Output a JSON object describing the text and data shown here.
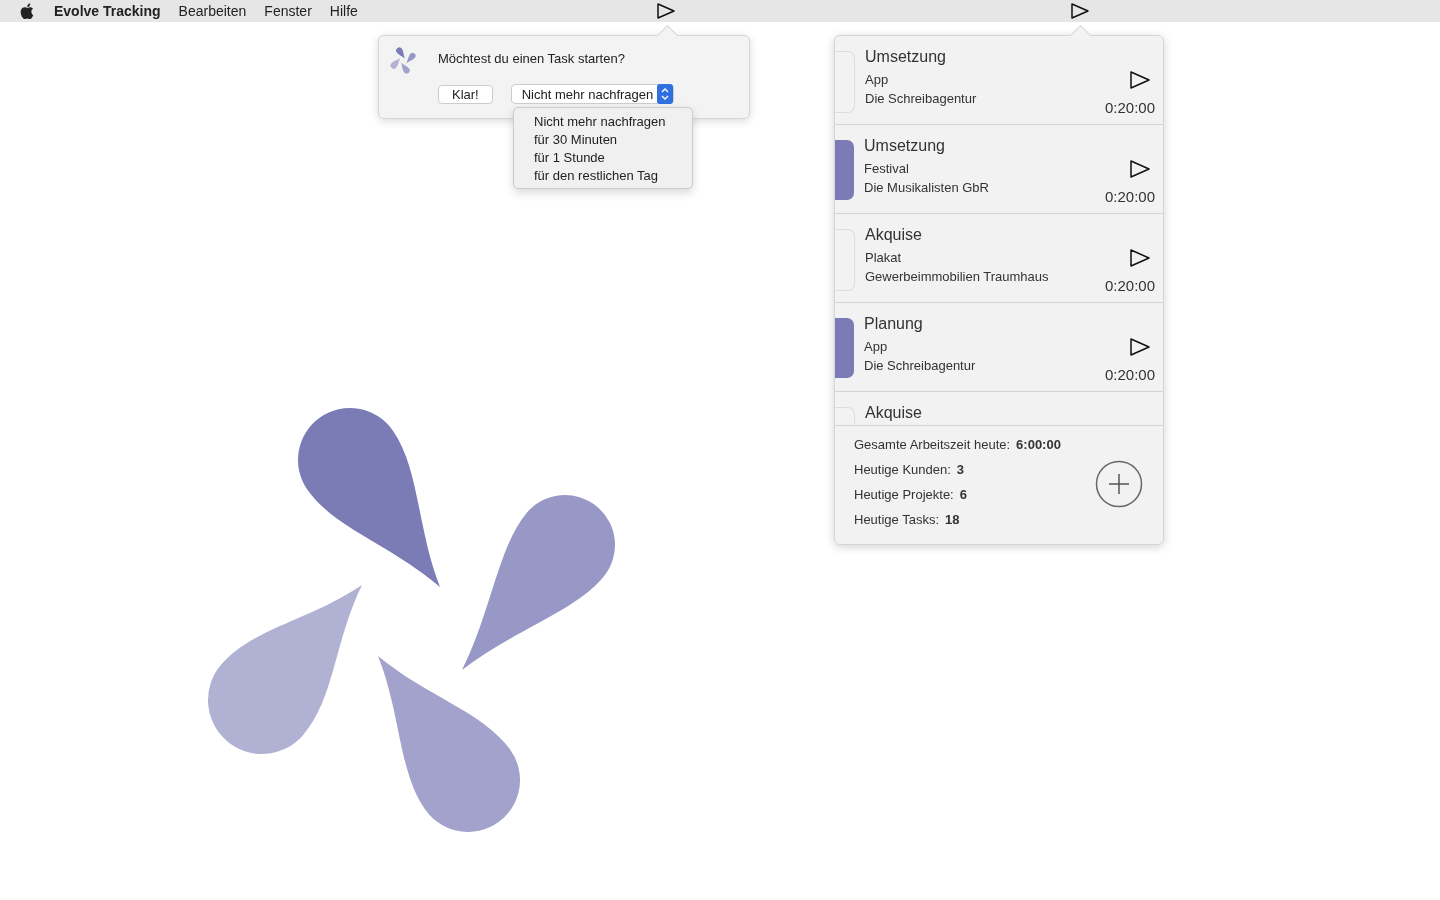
{
  "menu_bar": {
    "app_name": "Evolve Tracking",
    "menus": [
      "Bearbeiten",
      "Fenster",
      "Hilfe"
    ]
  },
  "prompt": {
    "message": "Möchtest du einen Task starten?",
    "ok_button": "Klar!",
    "select": {
      "value": "Nicht mehr nachfragen"
    },
    "options": [
      "Nicht mehr nachfragen",
      "für 30 Minuten",
      "für 1 Stunde",
      "für den restlichen Tag"
    ]
  },
  "tasks": [
    {
      "title": "Umsetzung",
      "project": "App",
      "client": "Die Schreibagentur",
      "time": "0:20:00",
      "marked": false
    },
    {
      "title": "Umsetzung",
      "project": "Festival",
      "client": "Die Musikalisten GbR",
      "time": "0:20:00",
      "marked": true
    },
    {
      "title": "Akquise",
      "project": "Plakat",
      "client": "Gewerbeimmobilien Traumhaus",
      "time": "0:20:00",
      "marked": false
    },
    {
      "title": "Planung",
      "project": "App",
      "client": "Die Schreibagentur",
      "time": "0:20:00",
      "marked": true
    },
    {
      "title": "Akquise",
      "marked": false
    }
  ],
  "summary": [
    {
      "label": "Gesamte Arbeitszeit heute:",
      "value": "6:00:00"
    },
    {
      "label": "Heutige Kunden:",
      "value": "3"
    },
    {
      "label": "Heutige Projekte:",
      "value": "6"
    },
    {
      "label": "Heutige Tasks:",
      "value": "18"
    }
  ]
}
